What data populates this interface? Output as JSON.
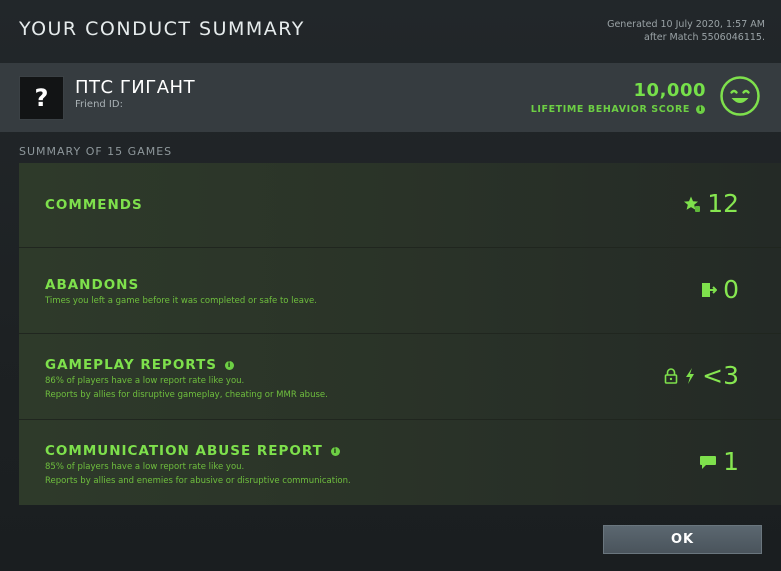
{
  "dialog": {
    "title": "YOUR CONDUCT SUMMARY",
    "generated_line1": "Generated 10 July 2020, 1:57 AM",
    "generated_line2": "after Match 5506046115."
  },
  "player": {
    "avatar_glyph": "?",
    "name": "ПТС ГИГАНТ",
    "friend_id_label": "Friend ID:",
    "score_value": "10,000",
    "score_label": "LIFETIME BEHAVIOR SCORE",
    "score_icon": "smiley-face-icon"
  },
  "summary": {
    "label": "SUMMARY OF 15 GAMES"
  },
  "rows": [
    {
      "title": "COMMENDS",
      "desc1": "",
      "desc2": "",
      "value": "12",
      "icon": "star-thumb-icon"
    },
    {
      "title": "ABANDONS",
      "desc1": "Times you left a game before it was completed or safe to leave.",
      "desc2": "",
      "value": "0",
      "icon": "exit-door-icon"
    },
    {
      "title": "GAMEPLAY REPORTS",
      "desc1": "86% of players have a low report rate like you.",
      "desc2": "Reports by allies for disruptive gameplay, cheating or MMR abuse.",
      "value": "<3",
      "icon": "lightning-icon"
    },
    {
      "title": "COMMUNICATION ABUSE REPORT",
      "desc1": "85% of players have a low report rate like you.",
      "desc2": "Reports by allies and enemies for abusive or disruptive communication.",
      "value": "1",
      "icon": "chat-bubble-icon"
    }
  ],
  "footer": {
    "ok_label": "OK"
  },
  "colors": {
    "accent_green": "#7ee04c",
    "background": "#1c2022",
    "player_bar": "#363c40",
    "button": "#525d65"
  }
}
